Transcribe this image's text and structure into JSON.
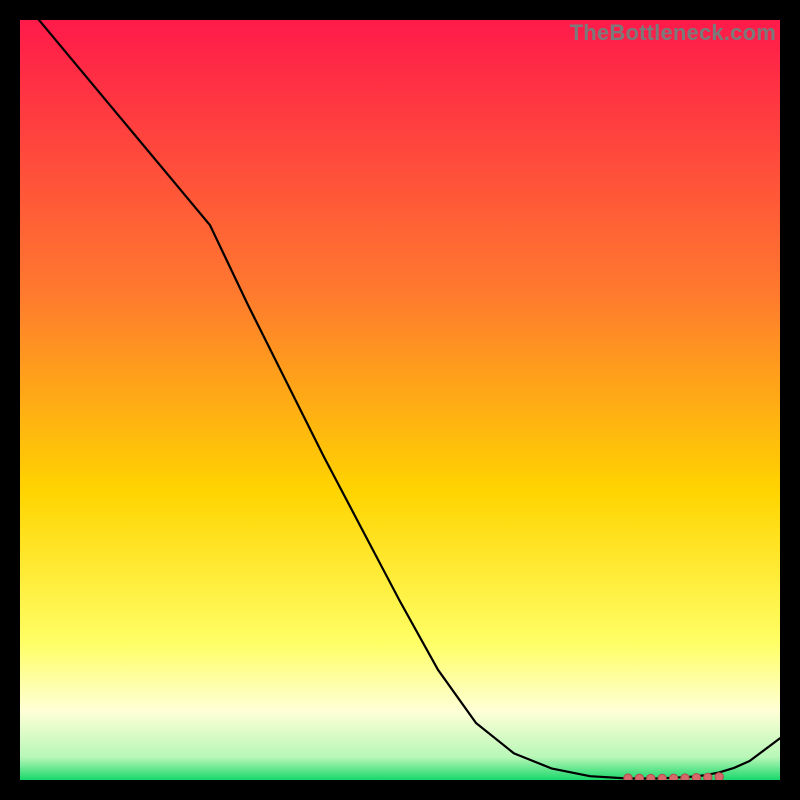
{
  "watermark": "TheBottleneck.com",
  "colors": {
    "top": "#ff1a4a",
    "mid_upper": "#ff7a2e",
    "mid": "#ffd400",
    "lower_yellow": "#ffff66",
    "pale": "#feffd6",
    "green": "#17d86a",
    "line": "#000000",
    "marker_fill": "#d46a6a",
    "marker_stroke": "#b24d4d",
    "frame": "#000000"
  },
  "chart_data": {
    "type": "line",
    "title": "",
    "xlabel": "",
    "ylabel": "",
    "xlim": [
      0,
      100
    ],
    "ylim": [
      0,
      100
    ],
    "grid": false,
    "legend": false,
    "series": [
      {
        "name": "curve",
        "x": [
          0,
          5,
          10,
          15,
          20,
          25,
          30,
          35,
          40,
          45,
          50,
          55,
          60,
          65,
          70,
          75,
          80,
          82,
          84,
          86,
          88,
          90,
          92,
          94,
          96,
          100
        ],
        "y": [
          103,
          97,
          91,
          85,
          79,
          73,
          62.5,
          52.5,
          42.5,
          33,
          23.5,
          14.5,
          7.5,
          3.5,
          1.5,
          0.5,
          0.2,
          0.2,
          0.2,
          0.3,
          0.4,
          0.6,
          1.0,
          1.6,
          2.5,
          5.5
        ]
      }
    ],
    "markers": {
      "name": "highlight-cluster",
      "x": [
        80,
        81.5,
        83,
        84.5,
        86,
        87.5,
        89,
        90.5,
        92
      ],
      "y": [
        0.25,
        0.22,
        0.2,
        0.2,
        0.22,
        0.25,
        0.3,
        0.35,
        0.42
      ]
    },
    "gradient_stops": [
      {
        "pct": 0,
        "color": "#ff1a4a"
      },
      {
        "pct": 36,
        "color": "#ff7a2e"
      },
      {
        "pct": 62,
        "color": "#ffd400"
      },
      {
        "pct": 82,
        "color": "#ffff66"
      },
      {
        "pct": 91,
        "color": "#feffd6"
      },
      {
        "pct": 97,
        "color": "#b7f7b7"
      },
      {
        "pct": 100,
        "color": "#17d86a"
      }
    ]
  }
}
